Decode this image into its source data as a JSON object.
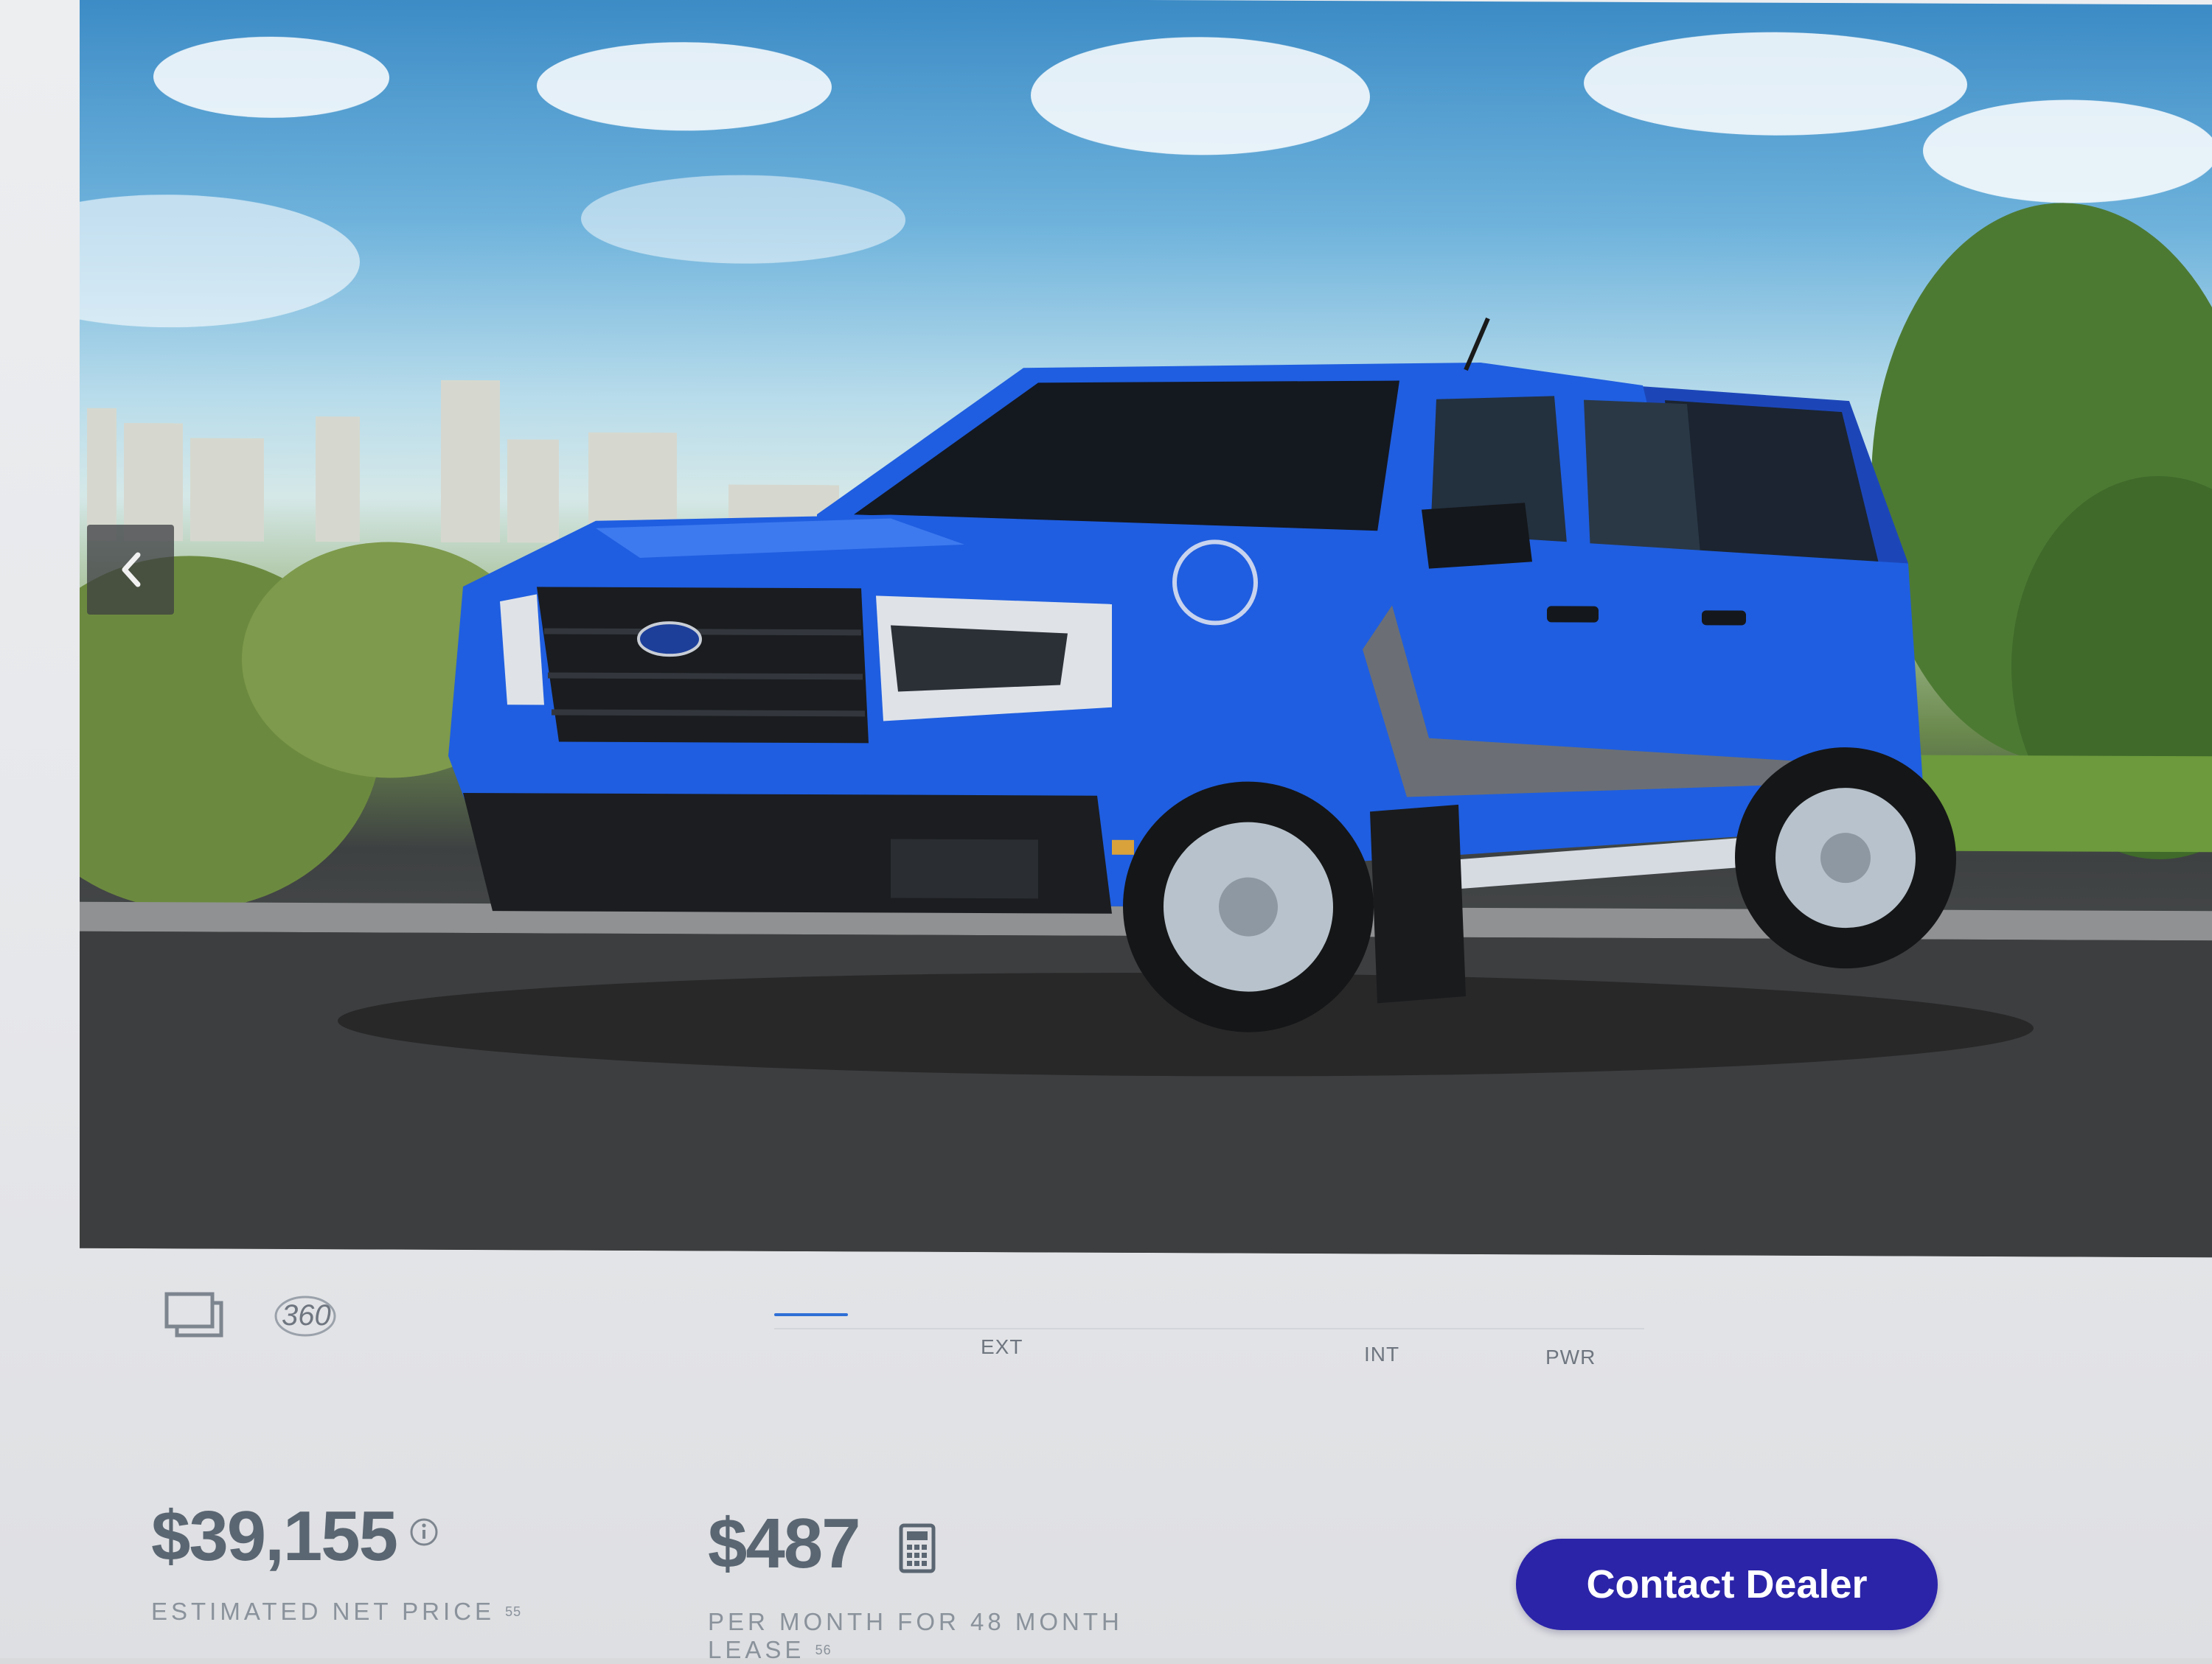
{
  "gallery": {
    "vehicle_image_alt": "Blue Ford Maverick pickup truck",
    "prev_icon": "chevron-left-icon",
    "view_gallery_icon": "gallery-frames-icon",
    "view_360_label": "360"
  },
  "tabs": [
    {
      "label": "EXT"
    },
    {
      "label": "INT"
    },
    {
      "label": "PWR"
    }
  ],
  "pricing": {
    "net_price": "$39,155",
    "net_price_label": "ESTIMATED NET PRICE",
    "net_price_footnote": "55",
    "info_icon": "info-icon",
    "monthly_price": "$487",
    "monthly_label": "PER MONTH FOR 48 MONTH LEASE",
    "monthly_footnote": "56",
    "calculator_icon": "calculator-icon"
  },
  "cta": {
    "contact_dealer_label": "Contact Dealer"
  },
  "colors": {
    "vehicle_blue": "#1f5ee0",
    "cta_background": "#2b24a8",
    "price_text": "#5a6672"
  }
}
